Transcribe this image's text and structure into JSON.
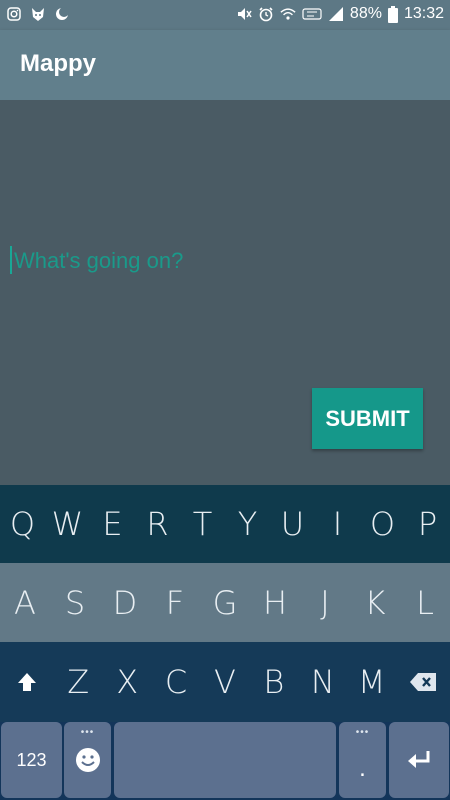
{
  "status_bar": {
    "battery": "88%",
    "time": "13:32",
    "left_icons": [
      "instagram-icon",
      "mask-icon",
      "moon-icon"
    ],
    "right_icons": [
      "mute-icon",
      "alarm-icon",
      "wifi-icon",
      "data-icon",
      "signal-icon",
      "battery-icon"
    ]
  },
  "app_bar": {
    "title": "Mappy"
  },
  "post": {
    "placeholder": "What's going on?",
    "submit_label": "SUBMIT"
  },
  "keyboard": {
    "row1": [
      "Q",
      "W",
      "E",
      "R",
      "T",
      "Y",
      "U",
      "I",
      "O",
      "P"
    ],
    "row2": [
      "A",
      "S",
      "D",
      "F",
      "G",
      "H",
      "J",
      "K",
      "L"
    ],
    "row3": [
      "Z",
      "X",
      "C",
      "V",
      "B",
      "N",
      "M"
    ],
    "numbers_label": "123",
    "period_label": ".",
    "dots": "•••"
  }
}
